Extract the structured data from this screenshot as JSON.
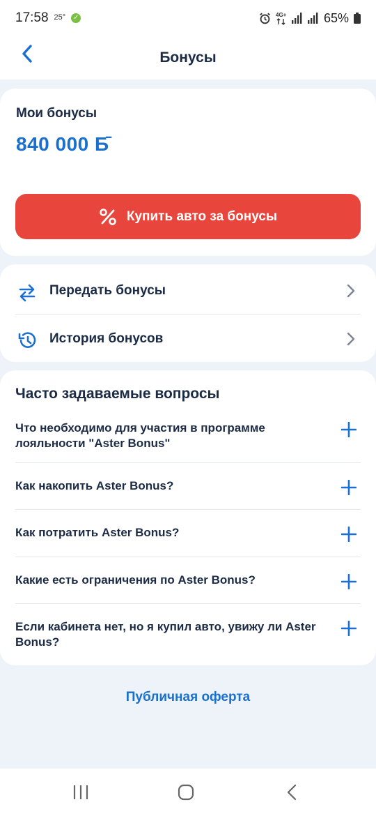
{
  "status_bar": {
    "time": "17:58",
    "temperature": "25°",
    "battery": "65%"
  },
  "header": {
    "title": "Бонусы"
  },
  "bonus_card": {
    "label": "Мои бонусы",
    "value": "840 000 Б̄",
    "buy_button_label": "Купить авто за бонусы"
  },
  "actions": [
    {
      "label": "Передать бонусы",
      "icon": "transfer-arrows-icon"
    },
    {
      "label": "История бонусов",
      "icon": "history-clock-icon"
    }
  ],
  "faq": {
    "title": "Часто задаваемые вопросы",
    "items": [
      {
        "question": "Что необходимо для участия в программе лояльности \"Aster Bonus\""
      },
      {
        "question": "Как накопить Aster Bonus?"
      },
      {
        "question": "Как потратить Aster Bonus?"
      },
      {
        "question": "Какие есть ограничения по Aster Bonus?"
      },
      {
        "question": "Если кабинета нет, но я купил авто, увижу ли Aster Bonus?"
      }
    ]
  },
  "footer": {
    "offer_link": "Публичная оферта"
  },
  "colors": {
    "accent_blue": "#1a6fcf",
    "button_red": "#e8453c",
    "text_dark": "#1c2b45",
    "background": "#eef3fa"
  }
}
